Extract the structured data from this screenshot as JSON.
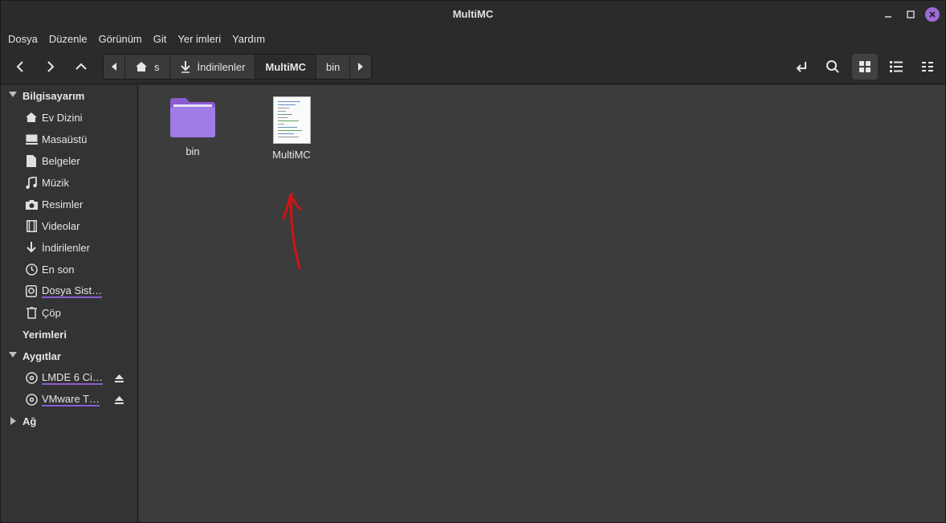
{
  "window": {
    "title": "MultiMC"
  },
  "menubar": {
    "items": [
      "Dosya",
      "Düzenle",
      "Görünüm",
      "Git",
      "Yer imleri",
      "Yardım"
    ]
  },
  "pathbar": {
    "crumbs": [
      "s",
      "İndirilenler",
      "MultiMC",
      "bin"
    ],
    "active": "MultiMC"
  },
  "toolbar": {
    "icons": [
      "back-icon",
      "forward-icon",
      "up-icon",
      "location-icon",
      "search-icon",
      "grid-view-icon",
      "list-view-icon",
      "menu-icon"
    ]
  },
  "sidebar": {
    "computer_header": "Bilgisayarım",
    "items": [
      {
        "label": "Ev Dizini",
        "icon": "home-icon"
      },
      {
        "label": "Masaüstü",
        "icon": "desktop-icon"
      },
      {
        "label": "Belgeler",
        "icon": "document-icon"
      },
      {
        "label": "Müzik",
        "icon": "music-icon"
      },
      {
        "label": "Resimler",
        "icon": "camera-icon"
      },
      {
        "label": "Videolar",
        "icon": "film-icon"
      },
      {
        "label": "İndirilenler",
        "icon": "download-icon"
      },
      {
        "label": "En son",
        "icon": "clock-icon"
      },
      {
        "label": "Dosya Sist…",
        "icon": "drive-icon"
      },
      {
        "label": "Çöp",
        "icon": "trash-icon"
      }
    ],
    "bookmarks_header": "Yerimleri",
    "devices_header": "Aygıtlar",
    "devices": [
      {
        "label": "LMDE 6 Ci…",
        "icon": "disc-icon"
      },
      {
        "label": "VMware T…",
        "icon": "disc-icon"
      }
    ],
    "network_header": "Ağ"
  },
  "files": [
    {
      "name": "bin",
      "type": "folder",
      "color": "#9c6ee0"
    },
    {
      "name": "MultiMC",
      "type": "script"
    }
  ],
  "colors": {
    "accent": "#9e6ad6",
    "annotation": "#d01414"
  }
}
